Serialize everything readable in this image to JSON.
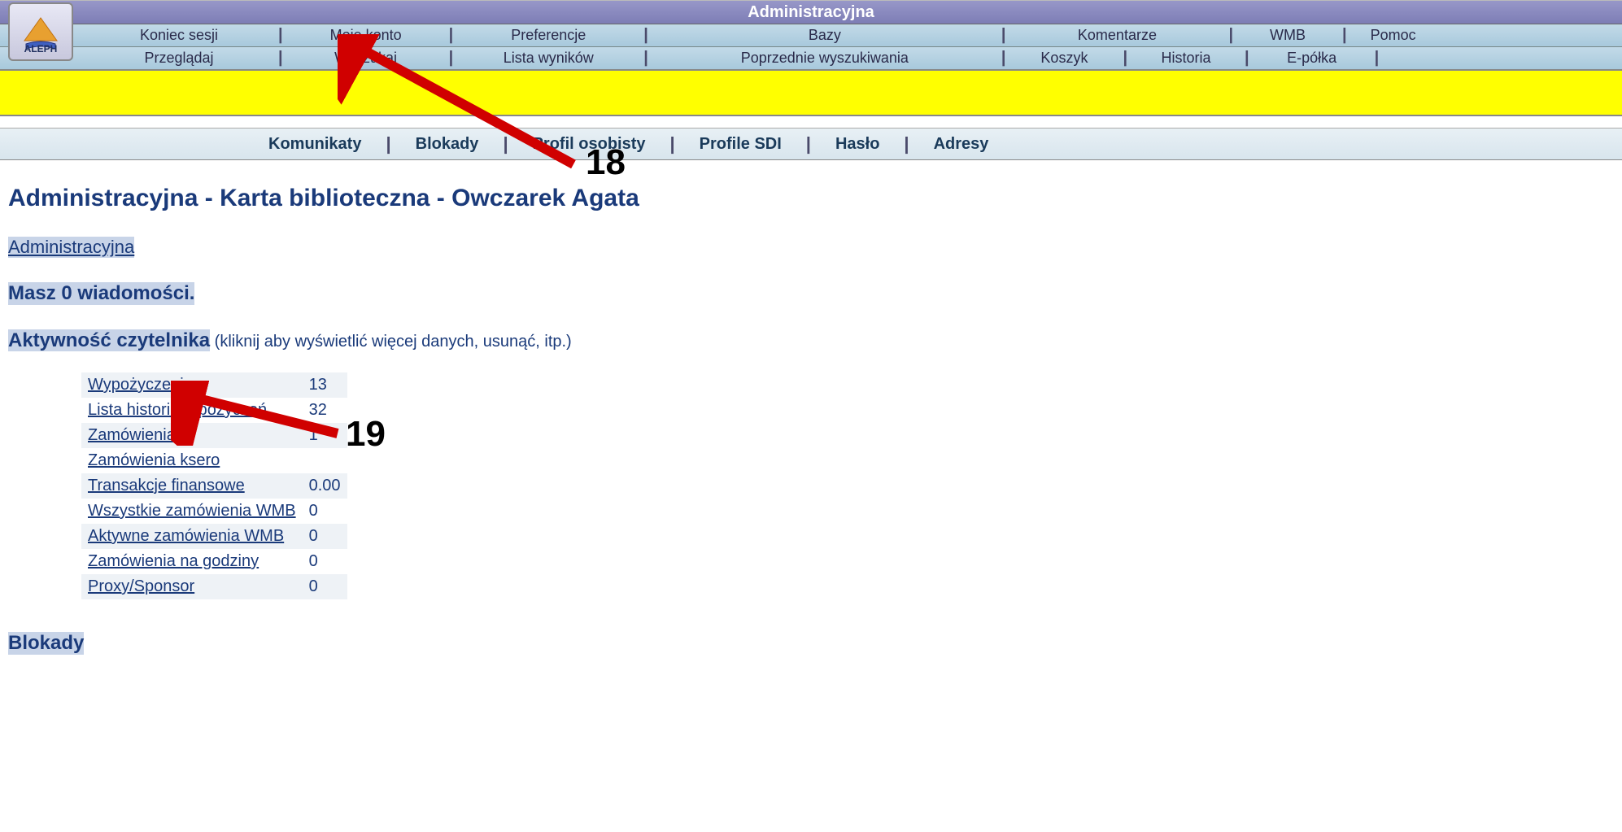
{
  "header": {
    "title": "Administracyjna"
  },
  "logo": {
    "text": "ALEPH"
  },
  "nav1": {
    "items": [
      "Koniec sesji",
      "Moje konto",
      "Preferencje",
      "Bazy",
      "Komentarze",
      "WMB",
      "Pomoc"
    ]
  },
  "nav2": {
    "items": [
      "Przeglądaj",
      "Wyszukaj",
      "Lista wyników",
      "Poprzednie wyszukiwania",
      "Koszyk",
      "Historia",
      "E-półka"
    ]
  },
  "subnav": {
    "items": [
      "Komunikaty",
      "Blokady",
      "Profil osobisty",
      "Profile SDI",
      "Hasło",
      "Adresy"
    ]
  },
  "page": {
    "title": "Administracyjna - Karta biblioteczna - Owczarek Agata",
    "admin_link": "Administracyjna",
    "messages": "Masz 0 wiadomości.",
    "activity_label": "Aktywność czytelnika",
    "activity_hint": " (kliknij aby wyświetlić więcej danych, usunąć, itp.)",
    "blocks": "Blokady"
  },
  "activity": {
    "rows": [
      {
        "label": "Wypożyczenia",
        "value": "13"
      },
      {
        "label": "Lista historii wypożyczeń",
        "value": "32"
      },
      {
        "label": "Zamówienia",
        "value": "1"
      },
      {
        "label": "Zamówienia ksero",
        "value": ""
      },
      {
        "label": "Transakcje finansowe",
        "value": "0.00"
      },
      {
        "label": "Wszystkie zamówienia WMB",
        "value": "0"
      },
      {
        "label": "Aktywne zamówienia WMB",
        "value": "0"
      },
      {
        "label": "Zamówienia na godziny",
        "value": "0"
      },
      {
        "label": "Proxy/Sponsor",
        "value": "0"
      }
    ]
  },
  "annotations": {
    "a18": "18",
    "a19": "19"
  }
}
